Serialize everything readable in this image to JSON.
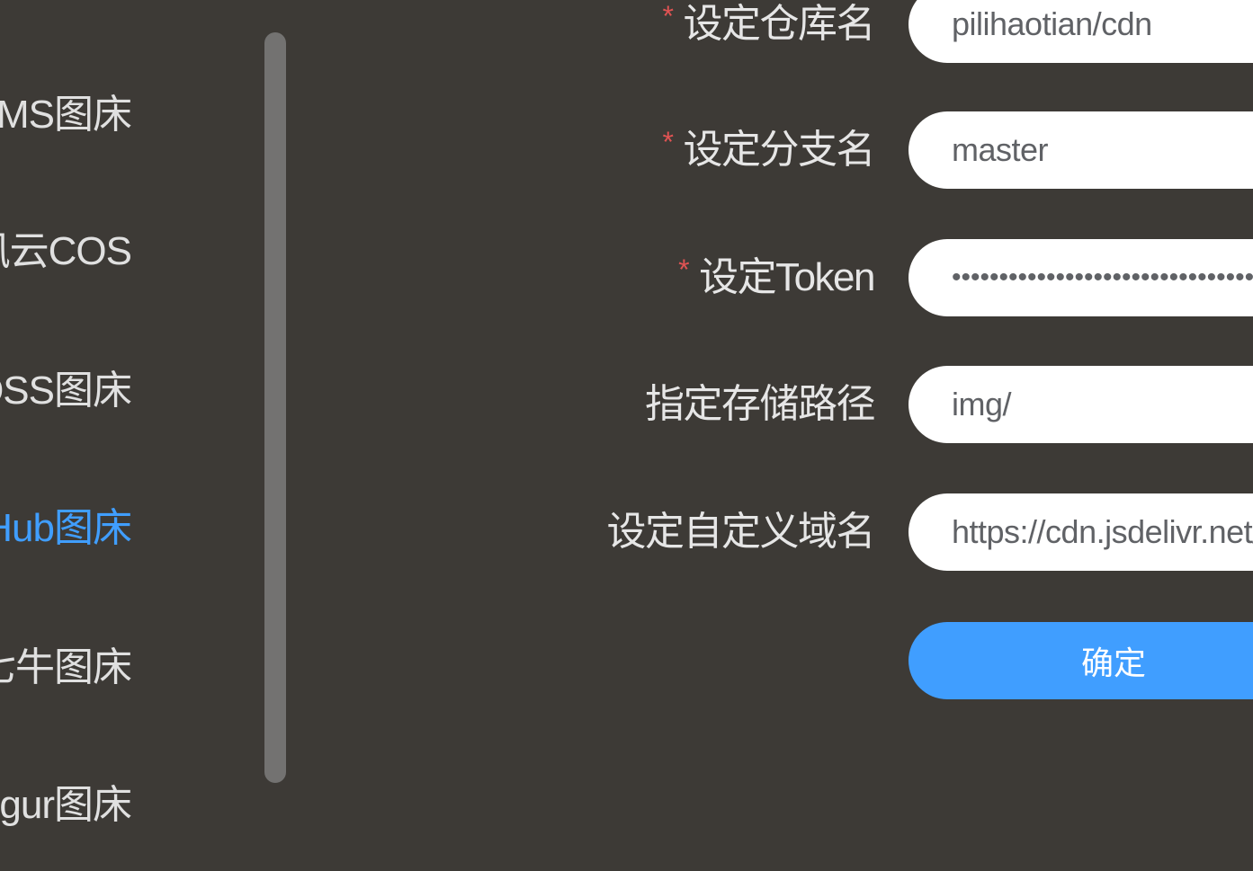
{
  "sidebar": {
    "items": [
      {
        "label": "LSKY PRO/SM.MS图床"
      },
      {
        "label": "腾讯云COS"
      },
      {
        "label": "阿里云OSS图床"
      },
      {
        "label": "GitHub图床"
      },
      {
        "label": "七牛图床"
      },
      {
        "label": "Imgur图床"
      }
    ],
    "active_index": 3
  },
  "form": {
    "repo": {
      "label": "设定仓库名",
      "required": "*",
      "value": "pilihaotian/cdn"
    },
    "branch": {
      "label": "设定分支名",
      "required": "*",
      "value": "master"
    },
    "token": {
      "label": "设定Token",
      "required": "*",
      "value": "•••••••••••••••••••••••••••••••••••"
    },
    "path": {
      "label": "指定存储路径",
      "value": "img/"
    },
    "domain": {
      "label": "设定自定义域名",
      "value": "https://cdn.jsdelivr.net/gh/pilihaotian/cdn"
    },
    "confirm_label": "确定"
  },
  "colors": {
    "background": "#3d3a36",
    "accent": "#409eff",
    "required": "#e05353",
    "scrollbar": "#737271"
  }
}
